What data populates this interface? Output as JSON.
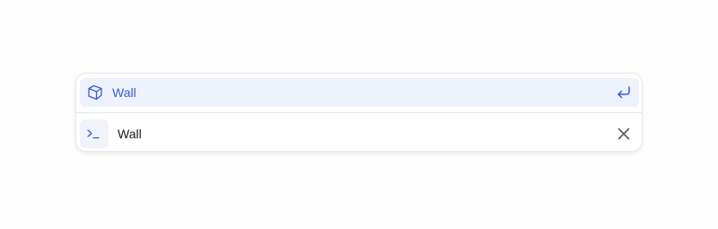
{
  "command_palette": {
    "suggestion": {
      "icon": "cube-icon",
      "label": "Wall",
      "action_icon": "enter-return-icon"
    },
    "input": {
      "icon": "terminal-prompt-icon",
      "value": "Wall",
      "clear_icon": "close-icon"
    },
    "colors": {
      "accent": "#3b5bd6",
      "highlight_bg": "#eef2fd",
      "text": "#1a1a1a"
    }
  }
}
